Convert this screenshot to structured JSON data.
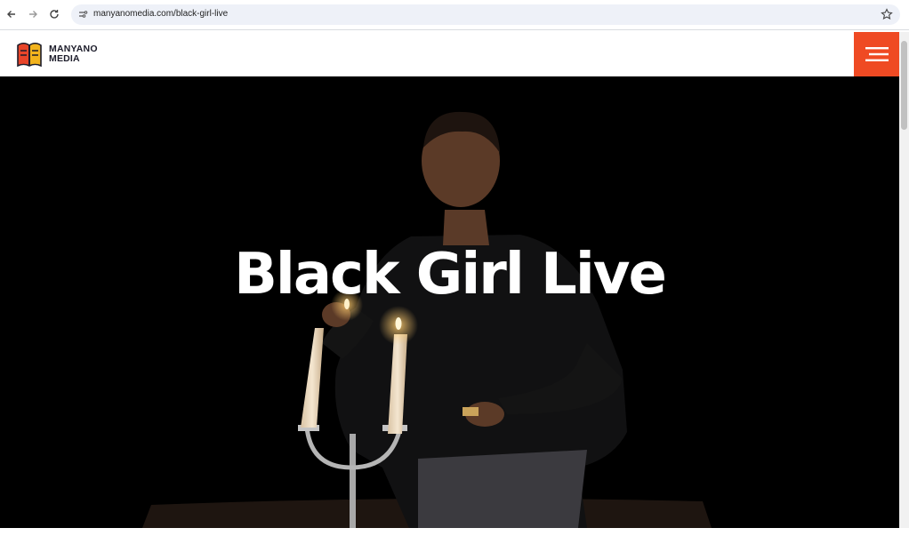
{
  "browser": {
    "url": "manyanomedia.com/black-girl-live",
    "icons": [
      "back-arrow-icon",
      "forward-arrow-icon",
      "reload-icon",
      "site-info-icon",
      "bookmark-star-icon"
    ]
  },
  "site": {
    "logo_line1": "MANYANO",
    "logo_line2": "MEDIA",
    "menu_icon": "hamburger-menu-icon",
    "accent_color": "#ef4a23"
  },
  "hero": {
    "title": "Black Girl Live"
  }
}
